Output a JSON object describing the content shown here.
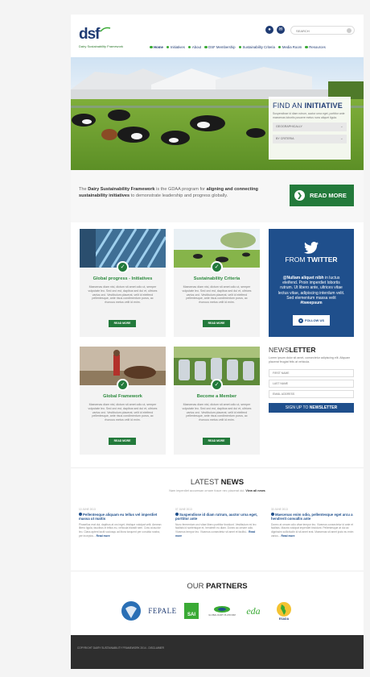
{
  "header": {
    "logo_text": "dsf",
    "logo_sub": "Dairy Sustainability Framework",
    "search_placeholder": "SEARCH",
    "nav": [
      {
        "label": "Home",
        "active": true
      },
      {
        "label": "Initiatives"
      },
      {
        "label": "About"
      },
      {
        "label": "DSF Membership"
      },
      {
        "label": "Sustainability Criteria"
      },
      {
        "label": "Media Room"
      },
      {
        "label": "Resources"
      }
    ]
  },
  "hero": {
    "find_title_a": "FIND AN ",
    "find_title_b": "INITIATIVE",
    "find_desc": "Suspendisse id diam rutrum, auctor urna eget, porttitor ante maecenas lobortis posuere metus nunc aliquet ligula.",
    "select_1": "GEOGRAPHICALLY",
    "select_2": "BY CRITERIA"
  },
  "intro": {
    "pre": "The ",
    "strong_1": "Dairy Sustainability Framework",
    "mid": " is the GDAA program for ",
    "strong_2": "aligning and connecting sustainability initiatives",
    "post": " to demonstrate leadership and progress globally.",
    "button": "READ MORE"
  },
  "cards": [
    {
      "title": "Global progress - Initiatives",
      "text": "Maecenas diam nisl, dictum sit amet odio ut, semper vulputate leo. Sed orci est, dapibus sed dui et, ultrices varius orci. Vestibulum placerat, velit id eleifend pellentesque, ante risus condimentum purus, ac rhoncus metus velit id enim.",
      "button": "READ MORE"
    },
    {
      "title": "Sustainability Criteria",
      "text": "Maecenas diam nisl, dictum sit amet odio ut, semper vulputate leo. Sed orci est, dapibus sed dui et, ultrices varius orci. Vestibulum placerat, velit id eleifend pellentesque, ante risus condimentum purus, ac rhoncus metus velit id enim.",
      "button": "READ MORE"
    },
    {
      "title": "Global Framework",
      "text": "Maecenas diam nisl, dictum sit amet odio ut, semper vulputate leo. Sed orci est, dapibus sed dui et, ultrices varius orci. Vestibulum placerat, velit id eleifend pellentesque, ante risus condimentum purus, ac rhoncus metus velit id enim.",
      "button": "READ MORE"
    },
    {
      "title": "Become a Member",
      "text": "Maecenas diam nisl, dictum sit amet odio ut, semper vulputate leo. Sed orci est, dapibus sed dui et, ultrices varius orci. Vestibulum placerat, velit id eleifend pellentesque, ante risus condimentum purus, ac rhoncus metus velit id enim.",
      "button": "READ MORE"
    }
  ],
  "twitter": {
    "title_a": "FROM ",
    "title_b": "TWITTER",
    "handle": "@Nullam aliquet nibh",
    "text": " in luctus eleifend. Proin imperdiet lobortis rutrum. Ut libero ante, ultrices vitae lectus vitae, adipiscing interdum velit. Sed elementum massa velit ",
    "hashtag": "#tweepsum",
    "follow": "FOLLOW US"
  },
  "newsletter": {
    "title_a": "NEWS",
    "title_b": "LETTER",
    "desc": "Lorem ipsum dolor sit amet, consectetur adipiscing elit. Aliquam placerat feugiat felis at vehicula.",
    "first_name": "FIRST NAME",
    "last_name": "LAST NAME",
    "email": "EMAIL ADDRESS",
    "button_a": "SIGN UP TO ",
    "button_b": "NEWSLETTER"
  },
  "news": {
    "title_a": "LATEST ",
    "title_b": "NEWS",
    "sub": "Nam imperdiet accumsan ornare fusce nec placerat dui. ",
    "view_all": "View all news",
    "items": [
      {
        "date": "10 JUNE 2013",
        "head": "Pellentesque aliquam eu tellus vel imperdiet massa ut mattis",
        "body": "Phasellus erat dui, dapibus at orci eget, tristique volutpat velit. Aenean libero ligula, faucibus in tellus eu, vehicula blandit sem. Cras at auctor leo. Class aptent taciti sociosqu ad litora torquent per conubia nostra, per inceptos... ",
        "more": "Read more"
      },
      {
        "date": "07 JUNE 2013",
        "head": "Suspendisse id diam rutrum, auctor urna eget, porttitor ante",
        "body": "Nunc fermentum orci vitae libero porttitor tincidunt. Vestibulum mi leo facilisis id scelerisque et, hendrerit eu diam. Donec ac ornare odio. Vivamus tempor leo. Vivamus consectetur sit amet et facilisi... ",
        "more": "Read more"
      },
      {
        "date": "30 JUNE 2013",
        "head": "Maecenas enim odio, pellentesque eget arcu a hendrerit convallis ante",
        "body": "Donec at ornare odio vitae tempor leo. Vivamus consectetur id ante et facilisis. Mauris volutpat imperdiet tincidunt. Pellentesque at dui ac dignissim sollicitudin id sit amet erat. Maecenas sit amet justo eu enim varius... ",
        "more": "Read more"
      }
    ]
  },
  "partners": {
    "title_a": "OUR ",
    "title_b": "PARTNERS",
    "logos": [
      "FEPALE",
      "SAI",
      "GLOBAL DAIRY PLATFORM",
      "eda",
      "ESADA"
    ]
  },
  "footer": {
    "text": "COPYRIGHT DAIRY SUSTAINABILITY FRAMEWORK 2014 - DISCLAIMER"
  }
}
